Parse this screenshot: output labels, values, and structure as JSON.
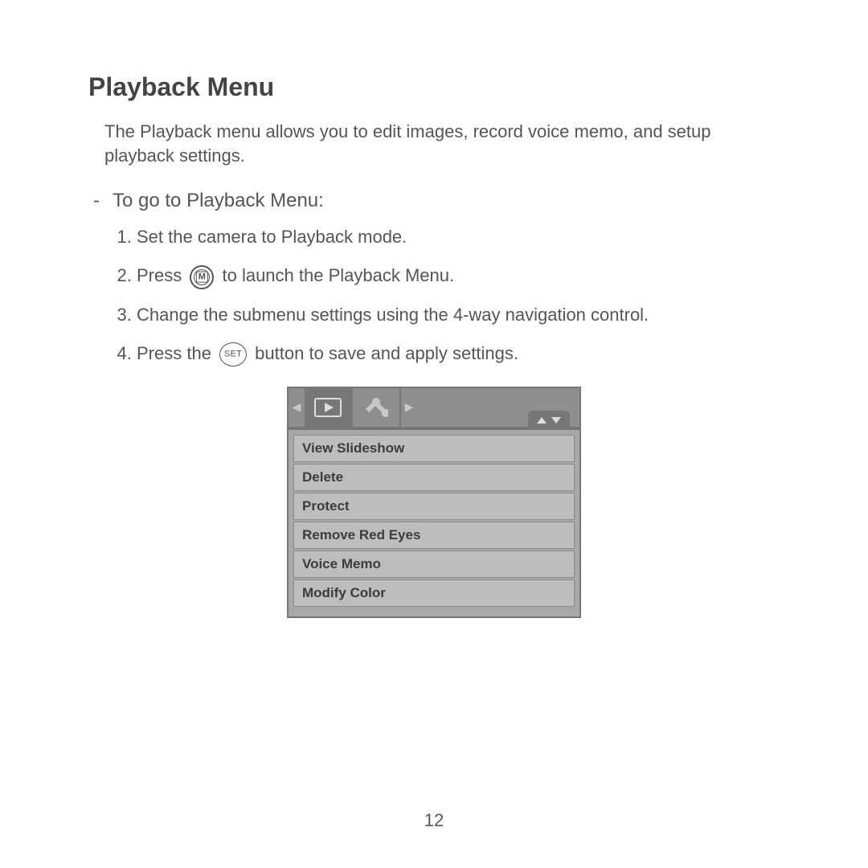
{
  "heading": "Playback Menu",
  "intro": "The Playback menu allows you to edit images, record voice memo, and setup playback settings.",
  "subheading_dash": "-",
  "subheading": "To go to Playback Menu:",
  "steps": {
    "s1": "Set the camera to Playback mode.",
    "s2a": "Press ",
    "s2b": " to launch the Playback Menu.",
    "s3": "Change the submenu settings using the 4-way navigation control.",
    "s4a": "Press the ",
    "s4b": " button to save and apply settings."
  },
  "icons": {
    "menu_button_letter": "M",
    "set_button_label": "SET"
  },
  "menu": {
    "items": [
      "View Slideshow",
      "Delete",
      "Protect",
      "Remove Red Eyes",
      "Voice Memo",
      "Modify Color"
    ]
  },
  "page_number": "12"
}
